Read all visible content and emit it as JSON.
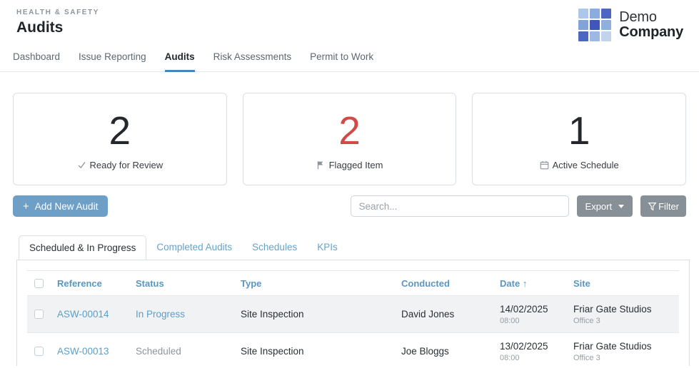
{
  "page": {
    "eyebrow": "HEALTH & SAFETY",
    "title": "Audits"
  },
  "logo": {
    "line1": "Demo",
    "line2": "Company",
    "grid_colors": [
      "#aec6e8",
      "#8badde",
      "#4c66c2",
      "#82a3d8",
      "#3f57ba",
      "#8fafdc",
      "#4c66c2",
      "#9db9e3",
      "#c2d3ee"
    ]
  },
  "nav": {
    "items": [
      {
        "label": "Dashboard",
        "active": false
      },
      {
        "label": "Issue Reporting",
        "active": false
      },
      {
        "label": "Audits",
        "active": true
      },
      {
        "label": "Risk Assessments",
        "active": false
      },
      {
        "label": "Permit to Work",
        "active": false
      }
    ]
  },
  "stats": [
    {
      "value": "2",
      "label": "Ready for Review",
      "icon": "check-icon",
      "value_color": "#24282c"
    },
    {
      "value": "2",
      "label": "Flagged Item",
      "icon": "flag-icon",
      "value_color": "#d04b47"
    },
    {
      "value": "1",
      "label": "Active Schedule",
      "icon": "calendar-icon",
      "value_color": "#24282c"
    }
  ],
  "toolbar": {
    "add_icon": "+",
    "add_label": "Add New Audit",
    "search_placeholder": "Search...",
    "export_label": "Export",
    "filter_label": "Filter"
  },
  "tabs": [
    {
      "label": "Scheduled & In Progress",
      "active": true
    },
    {
      "label": "Completed Audits",
      "active": false
    },
    {
      "label": "Schedules",
      "active": false
    },
    {
      "label": "KPIs",
      "active": false
    }
  ],
  "table": {
    "columns": [
      "Reference",
      "Status",
      "Type",
      "Conducted",
      "Date",
      "Site"
    ],
    "sort_column": "Date",
    "sort_indicator": "↑",
    "rows": [
      {
        "reference": "ASW-00014",
        "status": "In Progress",
        "type": "Site Inspection",
        "conducted": "David Jones",
        "date": "14/02/2025",
        "time": "08:00",
        "site": "Friar Gate Studios",
        "site_detail": "Office 3",
        "highlighted": true
      },
      {
        "reference": "ASW-00013",
        "status": "Scheduled",
        "type": "Site Inspection",
        "conducted": "Joe Bloggs",
        "date": "13/02/2025",
        "time": "08:00",
        "site": "Friar Gate Studios",
        "site_detail": "Office 3",
        "highlighted": false
      }
    ]
  },
  "colors": {
    "accent_blue": "#4285c4",
    "steel_blue": "#5b96be",
    "link_blue": "#5b9fc9",
    "button_blue": "#6d9fc7",
    "button_gray": "#878f97",
    "danger_red": "#d04b47",
    "muted_text": "#8d949b",
    "row_highlight": "#f1f2f4"
  }
}
